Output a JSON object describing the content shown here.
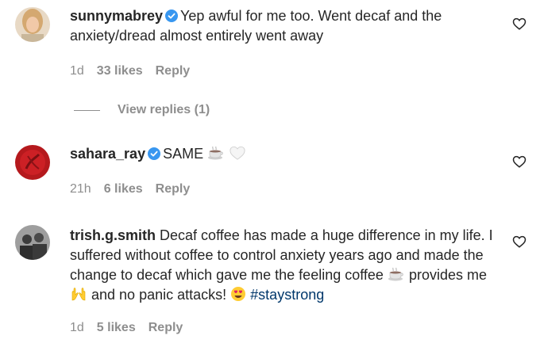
{
  "comments": [
    {
      "username": "sunnymabrey",
      "verified": true,
      "text": "Yep awful for me too. Went decaf and the anxiety/dread almost entirely went away",
      "time": "1d",
      "likes": "33 likes",
      "reply": "Reply",
      "view_replies": "View replies (1)"
    },
    {
      "username": "sahara_ray",
      "verified": true,
      "text": "SAME",
      "emoji": "coffee-and-white-heart",
      "time": "21h",
      "likes": "6 likes",
      "reply": "Reply"
    },
    {
      "username": "trish.g.smith",
      "verified": false,
      "text_part1": "Decaf coffee has made a huge difference in my life. I suffered without coffee to control anxiety years ago and made the change to decaf which gave me the feeling coffee",
      "text_part2": "provides me",
      "text_part3": "and no panic attacks!",
      "hashtag": "#staystrong",
      "time": "1d",
      "likes": "5 likes",
      "reply": "Reply"
    }
  ],
  "colors": {
    "text": "#262626",
    "muted": "#8e8e8e",
    "verified": "#3897f0",
    "hashtag": "#00376b"
  }
}
